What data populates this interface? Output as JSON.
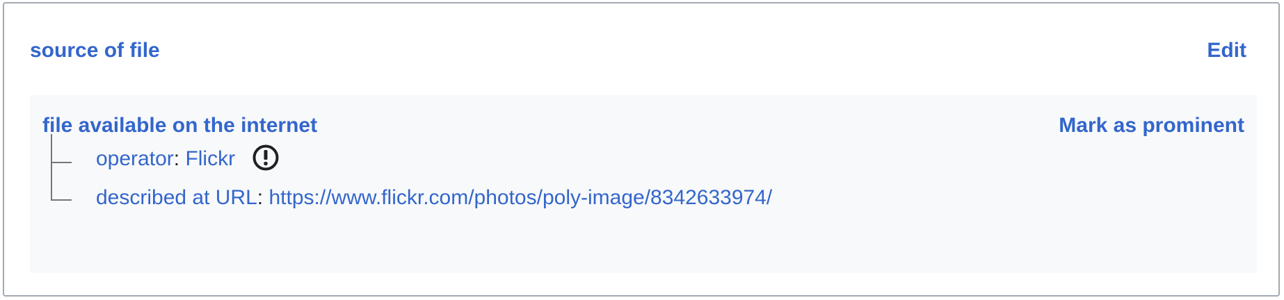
{
  "section": {
    "title": "source of file",
    "edit_label": "Edit"
  },
  "statement": {
    "value": "file available on the internet",
    "mark_label": "Mark as prominent",
    "qualifiers": [
      {
        "property": "operator",
        "separator": ":",
        "value": "Flickr",
        "has_warning": true
      },
      {
        "property": "described at URL",
        "separator": ":",
        "value": "https://www.flickr.com/photos/poly-image/8342633974/"
      }
    ]
  },
  "icons": {
    "warning": "exclamation-circle-icon"
  },
  "colors": {
    "link": "#3366cc",
    "panel_background": "#f8f9fa",
    "border": "#a2a9b1",
    "icon": "#202122"
  }
}
